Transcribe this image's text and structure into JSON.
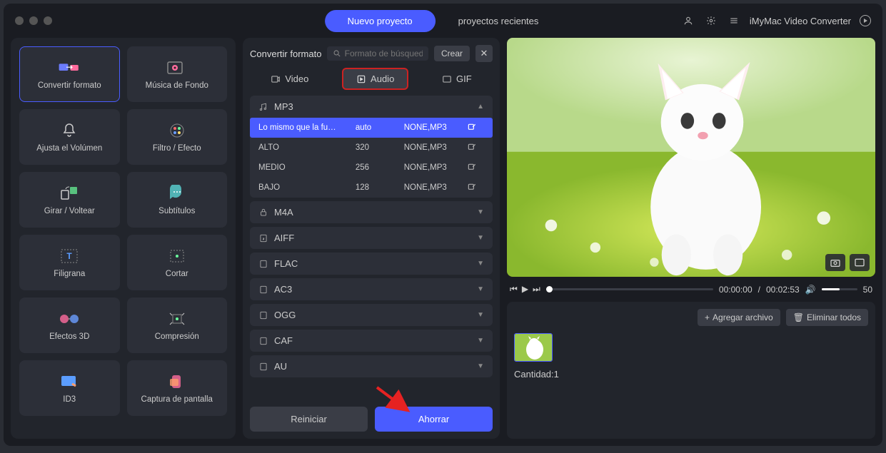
{
  "titlebar": {
    "tab_new_project": "Nuevo proyecto",
    "tab_recent_projects": "proyectos recientes",
    "app_name": "iMyMac Video Converter"
  },
  "sidebar": {
    "tiles": [
      {
        "label": "Convertir formato"
      },
      {
        "label": "Música de Fondo"
      },
      {
        "label": "Ajusta el Volúmen"
      },
      {
        "label": "Filtro / Efecto"
      },
      {
        "label": "Girar / Voltear"
      },
      {
        "label": "Subtítulos"
      },
      {
        "label": "Filigrana"
      },
      {
        "label": "Cortar"
      },
      {
        "label": "Efectos 3D"
      },
      {
        "label": "Compresión"
      },
      {
        "label": "ID3"
      },
      {
        "label": "Captura de pantalla"
      }
    ]
  },
  "center": {
    "title": "Convertir formato",
    "search_placeholder": "Formato de búsqueda",
    "create": "Crear",
    "tabs": {
      "video": "Video",
      "audio": "Audio",
      "gif": "GIF"
    },
    "mp3": {
      "name": "MP3",
      "rows": [
        {
          "q": "Lo mismo que la fu…",
          "br": "auto",
          "ext": "NONE,MP3"
        },
        {
          "q": "ALTO",
          "br": "320",
          "ext": "NONE,MP3"
        },
        {
          "q": "MEDIO",
          "br": "256",
          "ext": "NONE,MP3"
        },
        {
          "q": "BAJO",
          "br": "128",
          "ext": "NONE,MP3"
        }
      ]
    },
    "groups": [
      "M4A",
      "AIFF",
      "FLAC",
      "AC3",
      "OGG",
      "CAF",
      "AU"
    ],
    "reset": "Reiniciar",
    "save": "Ahorrar"
  },
  "player": {
    "time_current": "00:00:00",
    "time_total": "00:02:53",
    "volume": "50"
  },
  "bottom": {
    "add_file": "Agregar archivo",
    "remove_all": "Eliminar todos",
    "count_label": "Cantidad:",
    "count_value": "1"
  }
}
